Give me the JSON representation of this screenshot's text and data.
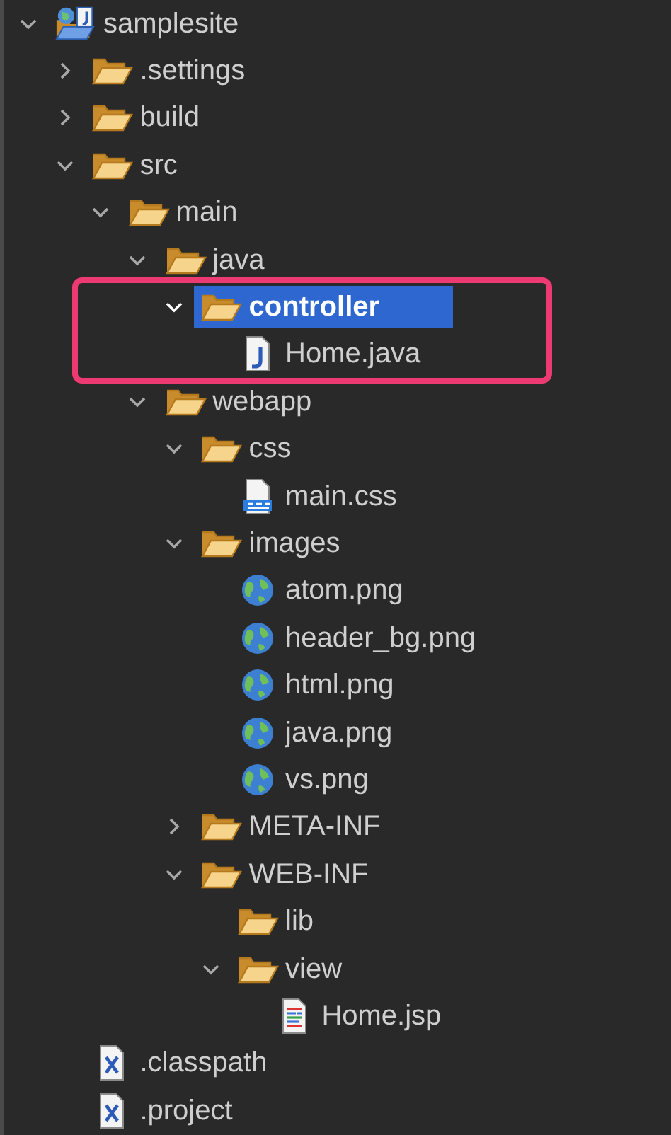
{
  "tree": [
    {
      "label": "samplesite",
      "kind": "project",
      "expanded": true,
      "selected": false,
      "children": [
        {
          "label": ".settings",
          "kind": "folder",
          "expanded": false,
          "selected": false
        },
        {
          "label": "build",
          "kind": "folder",
          "expanded": false,
          "selected": false
        },
        {
          "label": "src",
          "kind": "folder",
          "expanded": true,
          "selected": false,
          "children": [
            {
              "label": "main",
              "kind": "folder",
              "expanded": true,
              "selected": false,
              "children": [
                {
                  "label": "java",
                  "kind": "folder",
                  "expanded": true,
                  "selected": false,
                  "children": [
                    {
                      "label": "controller",
                      "kind": "folder",
                      "expanded": true,
                      "selected": true,
                      "highlighted": true,
                      "children": [
                        {
                          "label": "Home.java",
                          "kind": "java",
                          "selected": false
                        }
                      ]
                    }
                  ]
                },
                {
                  "label": "webapp",
                  "kind": "folder",
                  "expanded": true,
                  "selected": false,
                  "children": [
                    {
                      "label": "css",
                      "kind": "folder",
                      "expanded": true,
                      "selected": false,
                      "children": [
                        {
                          "label": "main.css",
                          "kind": "css",
                          "selected": false
                        }
                      ]
                    },
                    {
                      "label": "images",
                      "kind": "folder",
                      "expanded": true,
                      "selected": false,
                      "children": [
                        {
                          "label": "atom.png",
                          "kind": "image",
                          "selected": false
                        },
                        {
                          "label": "header_bg.png",
                          "kind": "image",
                          "selected": false
                        },
                        {
                          "label": "html.png",
                          "kind": "image",
                          "selected": false
                        },
                        {
                          "label": "java.png",
                          "kind": "image",
                          "selected": false
                        },
                        {
                          "label": "vs.png",
                          "kind": "image",
                          "selected": false
                        }
                      ]
                    },
                    {
                      "label": "META-INF",
                      "kind": "folder",
                      "expanded": false,
                      "selected": false
                    },
                    {
                      "label": "WEB-INF",
                      "kind": "folder",
                      "expanded": true,
                      "selected": false,
                      "children": [
                        {
                          "label": "lib",
                          "kind": "leaf-folder",
                          "selected": false
                        },
                        {
                          "label": "view",
                          "kind": "folder",
                          "expanded": true,
                          "selected": false,
                          "children": [
                            {
                              "label": "Home.jsp",
                              "kind": "jsp",
                              "selected": false
                            }
                          ]
                        }
                      ]
                    }
                  ]
                }
              ]
            }
          ]
        },
        {
          "label": ".classpath",
          "kind": "xml",
          "selected": false
        },
        {
          "label": ".project",
          "kind": "xml",
          "selected": false
        }
      ]
    }
  ]
}
